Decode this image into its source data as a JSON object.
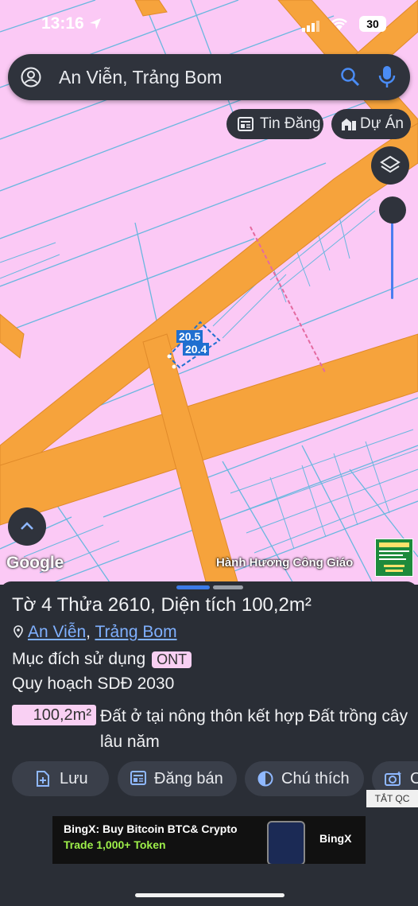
{
  "status_bar": {
    "time": "13:16",
    "battery": "30"
  },
  "search": {
    "text": "An Viễn, Trảng Bom"
  },
  "chips": {
    "news": "Tin Đăng",
    "projects": "Dự Án"
  },
  "map": {
    "attribution": "Google",
    "landmark": "Hành Hương Công Giáo",
    "dimension_1": "20.5",
    "dimension_2": "20.4",
    "colors": {
      "land": "#fbc9f5",
      "road": "#f6a33c",
      "parcel_line": "#69b7df"
    }
  },
  "sheet": {
    "title": "Tờ 4 Thửa 2610, Diện tích 100,2m²",
    "ward": "An Viễn",
    "separator": ", ",
    "district": "Trảng Bom",
    "purpose_label": "Mục đích sử dụng",
    "purpose_code": "ONT",
    "plan_label": "Quy hoạch SDĐ 2030",
    "area_value": "100,2m²",
    "area_description": "Đất ở tại nông thôn kết hợp Đất trồng cây lâu năm",
    "actions": {
      "save": "Lưu",
      "sell": "Đăng bán",
      "note": "Chú thích",
      "camera": "C"
    },
    "ad_label": "TẮT QC"
  },
  "ad": {
    "line1": "BingX: Buy Bitcoin BTC& Crypto",
    "line2": "Trade 1,000+ Token",
    "brand": "BingX"
  }
}
